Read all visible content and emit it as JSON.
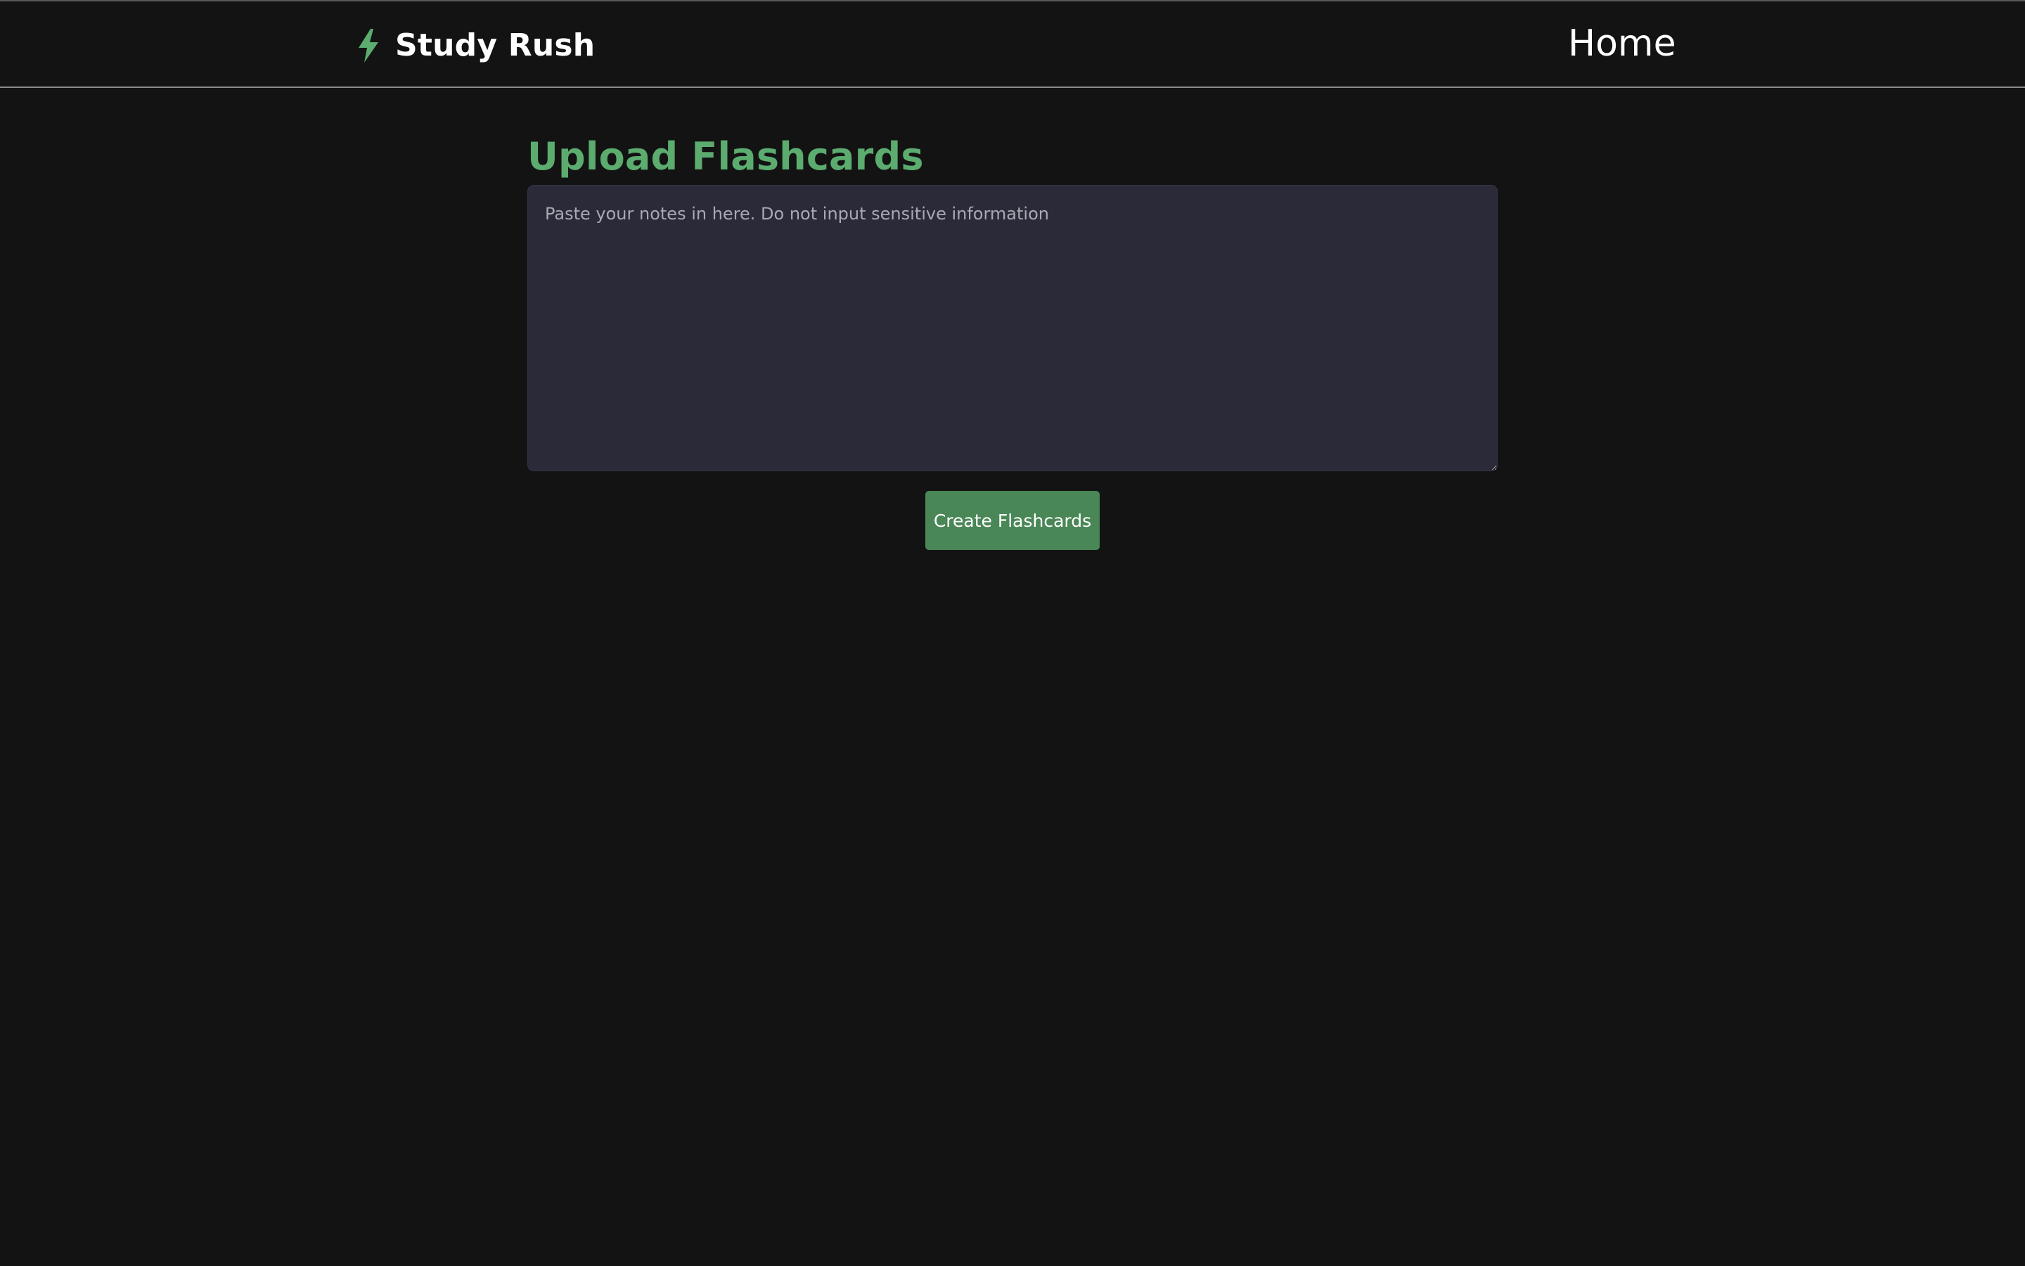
{
  "colors": {
    "background": "#131313",
    "accent": "#5bac6e",
    "button_bg": "#4a8757",
    "textarea_bg": "#2b2a39",
    "text_primary": "#ffffff"
  },
  "header": {
    "brand_icon": "lightning-bolt-icon",
    "brand_name": "Study Rush",
    "nav": {
      "home_label": "Home"
    }
  },
  "main": {
    "title": "Upload Flashcards",
    "notes_input": {
      "placeholder": "Paste your notes in here. Do not input sensitive information",
      "value": ""
    },
    "create_button_label": "Create Flashcards"
  }
}
